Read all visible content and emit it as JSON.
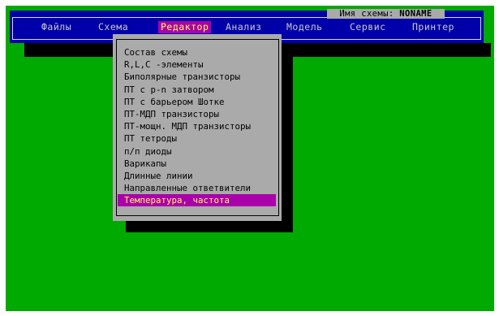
{
  "window": {
    "schema_name_label": "Имя схемы:",
    "schema_name_value": "NONAME"
  },
  "menubar": {
    "items": [
      {
        "label": "Файлы"
      },
      {
        "label": "Схема"
      },
      {
        "label": "Редактор",
        "active": true
      },
      {
        "label": "Анализ"
      },
      {
        "label": "Модель"
      },
      {
        "label": "Сервис"
      },
      {
        "label": "Принтер"
      }
    ]
  },
  "dropdown": {
    "items": [
      {
        "label": "Состав схемы"
      },
      {
        "label": "R,L,C -элементы"
      },
      {
        "label": "Биполярные транзисторы"
      },
      {
        "label": "ПТ с p-n затвором"
      },
      {
        "label": "ПТ с барьером Шотке"
      },
      {
        "label": "ПТ-МДП транзисторы"
      },
      {
        "label": "ПТ-мощн. МДП транзисторы"
      },
      {
        "label": "ПТ тетроды"
      },
      {
        "label": "п/п диоды"
      },
      {
        "label": "Варикапы"
      },
      {
        "label": "Длинные линии"
      },
      {
        "label": "Направленные ответвители"
      },
      {
        "label": "Температура, частота",
        "selected": true
      }
    ]
  },
  "colors": {
    "desktop": "#00aa00",
    "menubar": "#0000aa",
    "menu_text": "#c8c8c8",
    "highlight_bg": "#aa00aa",
    "highlight_text": "#ffff55",
    "dropdown_bg": "#aaaaaa"
  }
}
